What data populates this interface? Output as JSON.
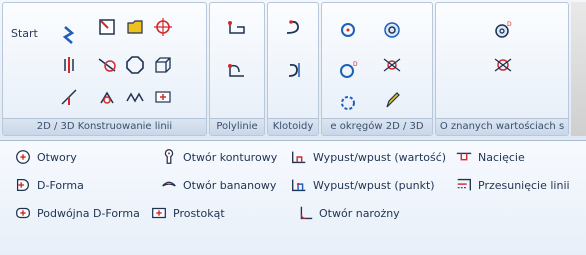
{
  "ribbon": {
    "start_label": "Start",
    "groups": [
      {
        "label": "2D / 3D Konstruowanie linii"
      },
      {
        "label": "Polylinie"
      },
      {
        "label": "Klotoidy"
      },
      {
        "label": "e okręgów 2D / 3D"
      },
      {
        "label": "O znanych wartościach s"
      }
    ]
  },
  "tools": [
    {
      "label": "Otwory"
    },
    {
      "label": "D-Forma"
    },
    {
      "label": "Podwójna D-Forma"
    },
    {
      "label": "Prostokąt"
    },
    {
      "label": "Otwór konturowy"
    },
    {
      "label": "Otwór bananowy"
    },
    {
      "label": "Wypust/wpust (wartość)"
    },
    {
      "label": "Wypust/wpust (punkt)"
    },
    {
      "label": "Otwór narożny"
    },
    {
      "label": "Nacięcie"
    },
    {
      "label": "Przesunięcie linii"
    }
  ],
  "colors": {
    "accent_red": "#d42a2a",
    "accent_blue": "#1f5fb8",
    "accent_yellow": "#f0c020"
  }
}
